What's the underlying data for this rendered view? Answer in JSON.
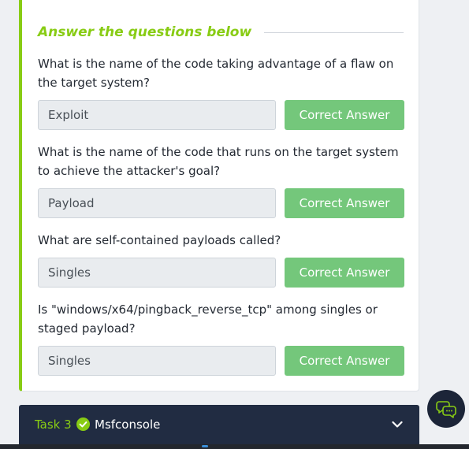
{
  "section": {
    "heading": "Answer the questions below"
  },
  "questions": [
    {
      "text": "What is the name of the code taking advantage of a flaw on the target system?",
      "answer": "Exploit",
      "status_label": "Correct Answer"
    },
    {
      "text": "What is the name of the code that runs on the target system to achieve the attacker's goal?",
      "answer": "Payload",
      "status_label": "Correct Answer"
    },
    {
      "text": "What are self-contained payloads called?",
      "answer": "Singles",
      "status_label": "Correct Answer"
    },
    {
      "text": "Is \"windows/x64/pingback_reverse_tcp\" among singles or staged payload?",
      "answer": "Singles",
      "status_label": "Correct Answer"
    }
  ],
  "next_task": {
    "number": "Task 3",
    "title": "Msfconsole",
    "completed_icon": "check-circle-icon",
    "expand_icon": "chevron-down-icon"
  },
  "chat": {
    "icon": "chat-bubble-icon"
  },
  "colors": {
    "accent_green": "#88cc14",
    "correct_button": "#74c77b",
    "task_bar": "#212c42"
  }
}
